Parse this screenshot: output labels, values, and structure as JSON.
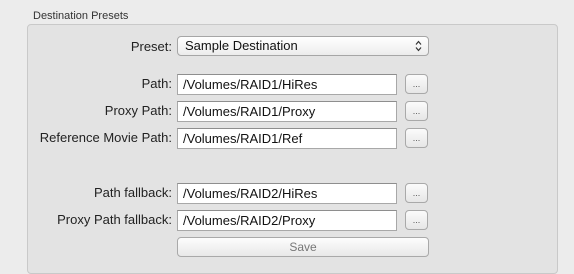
{
  "section": {
    "title": "Destination Presets"
  },
  "preset": {
    "label": "Preset:",
    "selected": "Sample Destination"
  },
  "fields": {
    "path": {
      "label": "Path:",
      "value": "/Volumes/RAID1/HiRes"
    },
    "proxy_path": {
      "label": "Proxy Path:",
      "value": "/Volumes/RAID1/Proxy"
    },
    "reference_movie_path": {
      "label": "Reference Movie Path:",
      "value": "/Volumes/RAID1/Ref"
    },
    "path_fallback": {
      "label": "Path fallback:",
      "value": "/Volumes/RAID2/HiRes"
    },
    "proxy_path_fallback": {
      "label": "Proxy Path fallback:",
      "value": "/Volumes/RAID2/Proxy"
    }
  },
  "browse_label": "...",
  "save_label": "Save",
  "icons": {
    "select_arrows": "updown-chevron-icon"
  }
}
